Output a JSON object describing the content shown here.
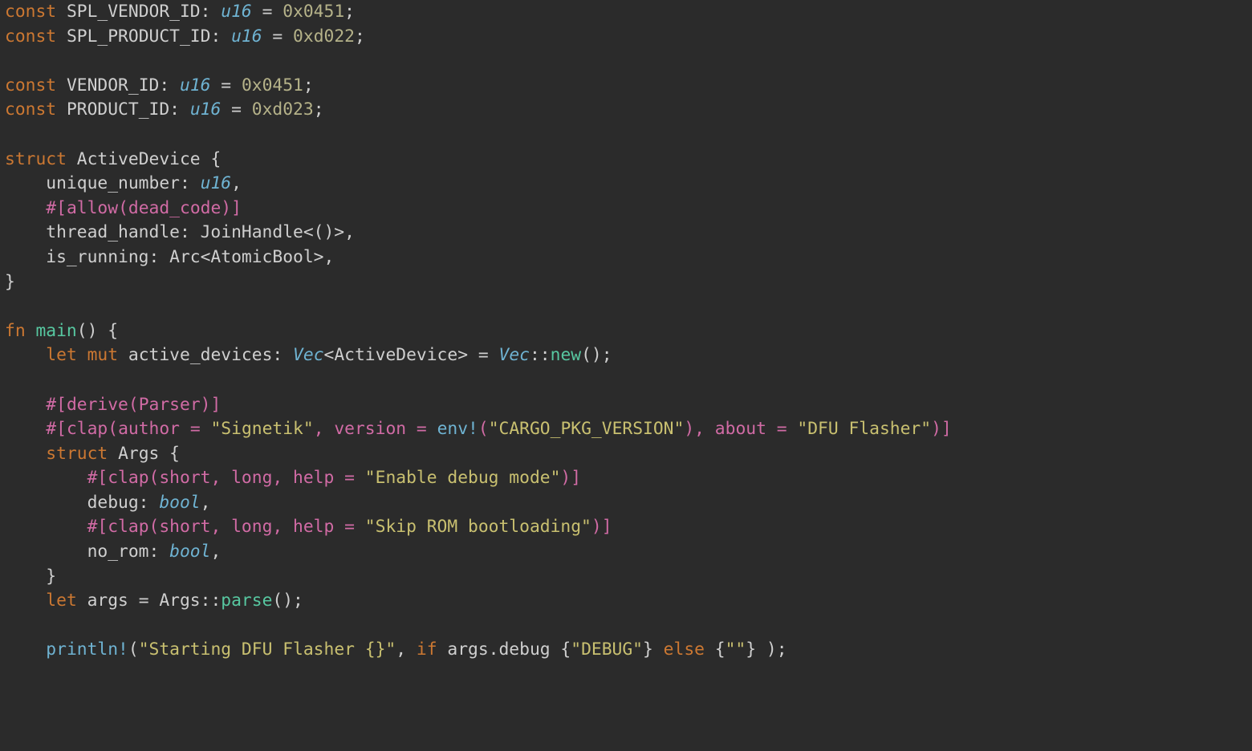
{
  "code": {
    "lines": [
      [
        {
          "t": "const ",
          "c": "kw"
        },
        {
          "t": "SPL_VENDOR_ID",
          "c": "id"
        },
        {
          "t": ": ",
          "c": "punct"
        },
        {
          "t": "u16",
          "c": "ty"
        },
        {
          "t": " = ",
          "c": "op"
        },
        {
          "t": "0x0451",
          "c": "num"
        },
        {
          "t": ";",
          "c": "punct"
        }
      ],
      [
        {
          "t": "const ",
          "c": "kw"
        },
        {
          "t": "SPL_PRODUCT_ID",
          "c": "id"
        },
        {
          "t": ": ",
          "c": "punct"
        },
        {
          "t": "u16",
          "c": "ty"
        },
        {
          "t": " = ",
          "c": "op"
        },
        {
          "t": "0xd022",
          "c": "num"
        },
        {
          "t": ";",
          "c": "punct"
        }
      ],
      [],
      [
        {
          "t": "const ",
          "c": "kw"
        },
        {
          "t": "VENDOR_ID",
          "c": "id"
        },
        {
          "t": ": ",
          "c": "punct"
        },
        {
          "t": "u16",
          "c": "ty"
        },
        {
          "t": " = ",
          "c": "op"
        },
        {
          "t": "0x0451",
          "c": "num"
        },
        {
          "t": ";",
          "c": "punct"
        }
      ],
      [
        {
          "t": "const ",
          "c": "kw"
        },
        {
          "t": "PRODUCT_ID",
          "c": "id"
        },
        {
          "t": ": ",
          "c": "punct"
        },
        {
          "t": "u16",
          "c": "ty"
        },
        {
          "t": " = ",
          "c": "op"
        },
        {
          "t": "0xd023",
          "c": "num"
        },
        {
          "t": ";",
          "c": "punct"
        }
      ],
      [],
      [
        {
          "t": "struct ",
          "c": "kw"
        },
        {
          "t": "ActiveDevice ",
          "c": "id"
        },
        {
          "t": "{",
          "c": "punct"
        }
      ],
      [
        {
          "t": "    unique_number: ",
          "c": "id"
        },
        {
          "t": "u16",
          "c": "ty"
        },
        {
          "t": ",",
          "c": "punct"
        }
      ],
      [
        {
          "t": "    ",
          "c": "id"
        },
        {
          "t": "#[",
          "c": "attr"
        },
        {
          "t": "allow",
          "c": "attr"
        },
        {
          "t": "(",
          "c": "attr"
        },
        {
          "t": "dead_code",
          "c": "attr"
        },
        {
          "t": ")",
          "c": "attr"
        },
        {
          "t": "]",
          "c": "attr"
        }
      ],
      [
        {
          "t": "    thread_handle: JoinHandle<()>,",
          "c": "id"
        }
      ],
      [
        {
          "t": "    is_running: Arc<AtomicBool>,",
          "c": "id"
        }
      ],
      [
        {
          "t": "}",
          "c": "punct"
        }
      ],
      [],
      [
        {
          "t": "fn ",
          "c": "kw"
        },
        {
          "t": "main",
          "c": "fnname"
        },
        {
          "t": "() {",
          "c": "punct"
        }
      ],
      [
        {
          "t": "    ",
          "c": "id"
        },
        {
          "t": "let ",
          "c": "kw"
        },
        {
          "t": "mut ",
          "c": "kw"
        },
        {
          "t": "active_devices: ",
          "c": "id"
        },
        {
          "t": "Vec",
          "c": "ty"
        },
        {
          "t": "<ActiveDevice> = ",
          "c": "id"
        },
        {
          "t": "Vec",
          "c": "ty"
        },
        {
          "t": "::",
          "c": "punct"
        },
        {
          "t": "new",
          "c": "fnname"
        },
        {
          "t": "();",
          "c": "punct"
        }
      ],
      [],
      [
        {
          "t": "    ",
          "c": "id"
        },
        {
          "t": "#[",
          "c": "attr"
        },
        {
          "t": "derive",
          "c": "attr"
        },
        {
          "t": "(",
          "c": "attr"
        },
        {
          "t": "Parser",
          "c": "attr"
        },
        {
          "t": ")",
          "c": "attr"
        },
        {
          "t": "]",
          "c": "attr"
        }
      ],
      [
        {
          "t": "    ",
          "c": "id"
        },
        {
          "t": "#[",
          "c": "attr"
        },
        {
          "t": "clap",
          "c": "attr"
        },
        {
          "t": "(",
          "c": "attr"
        },
        {
          "t": "author = ",
          "c": "attr"
        },
        {
          "t": "\"Signetik\"",
          "c": "str"
        },
        {
          "t": ", version = ",
          "c": "attr"
        },
        {
          "t": "env!",
          "c": "macro"
        },
        {
          "t": "(",
          "c": "attr"
        },
        {
          "t": "\"CARGO_PKG_VERSION\"",
          "c": "str"
        },
        {
          "t": ")",
          "c": "attr"
        },
        {
          "t": ", about = ",
          "c": "attr"
        },
        {
          "t": "\"DFU Flasher\"",
          "c": "str"
        },
        {
          "t": ")",
          "c": "attr"
        },
        {
          "t": "]",
          "c": "attr"
        }
      ],
      [
        {
          "t": "    ",
          "c": "id"
        },
        {
          "t": "struct ",
          "c": "kw"
        },
        {
          "t": "Args ",
          "c": "id"
        },
        {
          "t": "{",
          "c": "punct"
        }
      ],
      [
        {
          "t": "        ",
          "c": "id"
        },
        {
          "t": "#[",
          "c": "attr"
        },
        {
          "t": "clap",
          "c": "attr"
        },
        {
          "t": "(",
          "c": "attr"
        },
        {
          "t": "short, long, help = ",
          "c": "attr"
        },
        {
          "t": "\"Enable debug mode\"",
          "c": "str"
        },
        {
          "t": ")",
          "c": "attr"
        },
        {
          "t": "]",
          "c": "attr"
        }
      ],
      [
        {
          "t": "        debug: ",
          "c": "id"
        },
        {
          "t": "bool",
          "c": "ty"
        },
        {
          "t": ",",
          "c": "punct"
        }
      ],
      [
        {
          "t": "        ",
          "c": "id"
        },
        {
          "t": "#[",
          "c": "attr"
        },
        {
          "t": "clap",
          "c": "attr"
        },
        {
          "t": "(",
          "c": "attr"
        },
        {
          "t": "short, long, help = ",
          "c": "attr"
        },
        {
          "t": "\"Skip ROM bootloading\"",
          "c": "str"
        },
        {
          "t": ")",
          "c": "attr"
        },
        {
          "t": "]",
          "c": "attr"
        }
      ],
      [
        {
          "t": "        no_rom: ",
          "c": "id"
        },
        {
          "t": "bool",
          "c": "ty"
        },
        {
          "t": ",",
          "c": "punct"
        }
      ],
      [
        {
          "t": "    }",
          "c": "punct"
        }
      ],
      [
        {
          "t": "    ",
          "c": "id"
        },
        {
          "t": "let ",
          "c": "kw"
        },
        {
          "t": "args = Args::",
          "c": "id"
        },
        {
          "t": "parse",
          "c": "fnname"
        },
        {
          "t": "();",
          "c": "punct"
        }
      ],
      [],
      [
        {
          "t": "    ",
          "c": "id"
        },
        {
          "t": "println!",
          "c": "macro"
        },
        {
          "t": "(",
          "c": "punct"
        },
        {
          "t": "\"Starting DFU Flasher {}\"",
          "c": "str"
        },
        {
          "t": ", ",
          "c": "punct"
        },
        {
          "t": "if ",
          "c": "kw"
        },
        {
          "t": "args.debug ",
          "c": "id"
        },
        {
          "t": "{",
          "c": "punct"
        },
        {
          "t": "\"DEBUG\"",
          "c": "str"
        },
        {
          "t": "} ",
          "c": "punct"
        },
        {
          "t": "else ",
          "c": "kw"
        },
        {
          "t": "{",
          "c": "punct"
        },
        {
          "t": "\"\"",
          "c": "str"
        },
        {
          "t": "} );",
          "c": "punct"
        }
      ]
    ]
  }
}
